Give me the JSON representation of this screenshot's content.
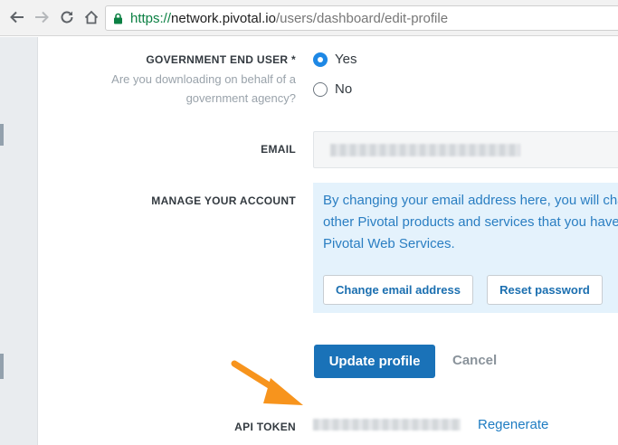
{
  "browser": {
    "url_scheme": "https://",
    "url_host": "network.pivotal.io",
    "url_path": "/users/dashboard/edit-profile"
  },
  "form": {
    "government": {
      "label": "GOVERNMENT END USER *",
      "hint": "Are you downloading on behalf of a government agency?",
      "options": [
        "Yes",
        "No"
      ],
      "selected": "Yes"
    },
    "email": {
      "label": "EMAIL"
    },
    "manage": {
      "label": "MANAGE YOUR ACCOUNT",
      "info_lines": [
        "By changing your email address here, you will cha",
        "other Pivotal products and services that you have",
        "Pivotal Web Services."
      ],
      "change_email_label": "Change email address",
      "reset_password_label": "Reset password"
    },
    "actions": {
      "update_label": "Update profile",
      "cancel_label": "Cancel"
    },
    "api_token": {
      "label": "API TOKEN",
      "regenerate_label": "Regenerate"
    }
  },
  "colors": {
    "primary": "#1a72b8",
    "radio_selected": "#1e88e5",
    "info_bg": "#e4f2fc",
    "info_text": "#2a7ec2",
    "annotation_arrow": "#f7941d"
  }
}
